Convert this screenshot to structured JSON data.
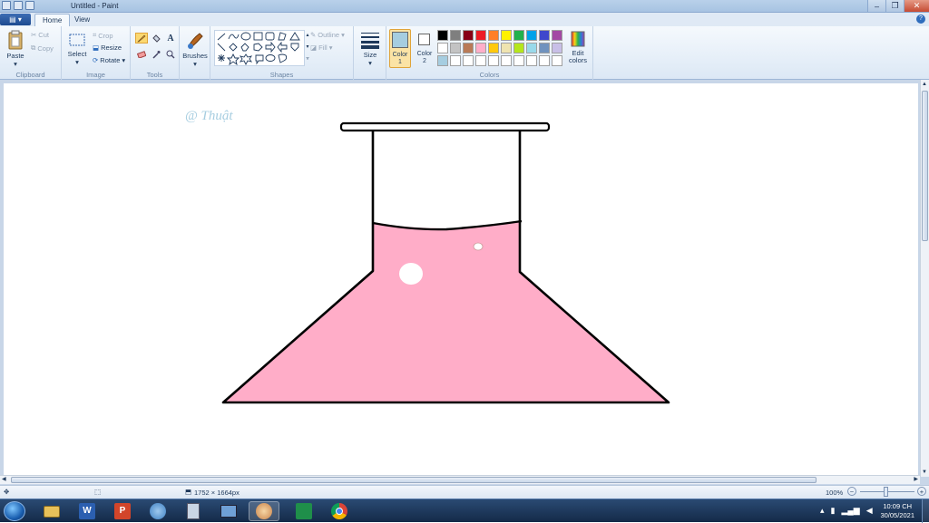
{
  "window": {
    "title": "Untitled - Paint"
  },
  "tabs": {
    "home": "Home",
    "view": "View"
  },
  "clipboard": {
    "paste": "Paste",
    "cut": "Cut",
    "copy": "Copy",
    "group": "Clipboard"
  },
  "image": {
    "select": "Select",
    "crop": "Crop",
    "resize": "Resize",
    "rotate": "Rotate",
    "group": "Image"
  },
  "tools": {
    "group": "Tools",
    "brushes": "Brushes"
  },
  "shapes": {
    "group": "Shapes",
    "outline": "Outline",
    "fill": "Fill",
    "size": "Size"
  },
  "colors": {
    "group": "Colors",
    "color1": "Color 1",
    "color1_line1": "Color",
    "color1_line2": "1",
    "color2": "Color 2",
    "color2_line1": "Color",
    "color2_line2": "2",
    "edit_line1": "Edit",
    "edit_line2": "colors",
    "color1_value": "#a6cde0",
    "color2_value": "#ffffff",
    "palette_row1": [
      "#000000",
      "#7f7f7f",
      "#880015",
      "#ed1c24",
      "#ff7f27",
      "#fff200",
      "#22b14c",
      "#00a2e8",
      "#3f48cc",
      "#a349a4"
    ],
    "palette_row2": [
      "#ffffff",
      "#c3c3c3",
      "#b97a57",
      "#ffaec9",
      "#ffc90e",
      "#efe4b0",
      "#b5e61d",
      "#99d9ea",
      "#7092be",
      "#c8bfe7"
    ],
    "palette_row3": [
      "#a6cde0",
      "#ffffff",
      "#ffffff",
      "#ffffff",
      "#ffffff",
      "#ffffff",
      "#ffffff",
      "#ffffff",
      "#ffffff",
      "#ffffff"
    ]
  },
  "drawing": {
    "signature": "@ Thuật",
    "liquid_color": "#ffadc8"
  },
  "status": {
    "dimensions": "1752 × 1664px",
    "zoom": "100%"
  },
  "clock": {
    "time": "10:09 CH",
    "date": "30/05/2021"
  }
}
